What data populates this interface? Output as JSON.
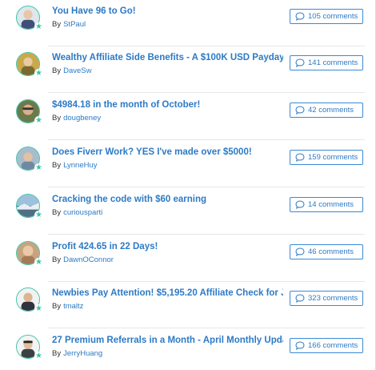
{
  "posts": [
    {
      "title": "You Have 96 to Go!",
      "by_label": "By",
      "author": "StPaul",
      "comments": "105 comments",
      "avatar_color": "#3f4f7a"
    },
    {
      "title": "Wealthy Affiliate Side Benefits - A $100K USD Payday",
      "by_label": "By",
      "author": "DaveSw",
      "comments": "141 comments",
      "avatar_color": "#7a6a32"
    },
    {
      "title": "$4984.18 in the month of October!",
      "by_label": "By",
      "author": "dougbeney",
      "comments": "42 comments",
      "avatar_color": "#5b4a32"
    },
    {
      "title": "Does Fiverr Work? YES I've made over $5000!",
      "by_label": "By",
      "author": "LynneHuy",
      "comments": "159 comments",
      "avatar_color": "#8fa7b8"
    },
    {
      "title": "Cracking the code with $60 earning",
      "by_label": "By",
      "author": "curiousparti",
      "comments": "14 comments",
      "avatar_color": "#5d7f98"
    },
    {
      "title": "Profit 424.65 in 22 Days!",
      "by_label": "By",
      "author": "DawnOConnor",
      "comments": "46 comments",
      "avatar_color": "#a57a58"
    },
    {
      "title": "Newbies Pay Attention! $5,195.20 Affiliate Check for J",
      "by_label": "By",
      "author": "tmaltz",
      "comments": "323 comments",
      "avatar_color": "#2f3340"
    },
    {
      "title": "27 Premium Referrals in a Month - April Monthly Upda",
      "by_label": "By",
      "author": "JerryHuang",
      "comments": "166 comments",
      "avatar_color": "#3c3f44"
    }
  ],
  "icons": {
    "badge": "star-badge-icon",
    "comments": "speech-bubble-icon"
  },
  "colors": {
    "link": "#2d7ac6",
    "badge": "#41c4a6",
    "button_border": "#3a8ad6"
  }
}
